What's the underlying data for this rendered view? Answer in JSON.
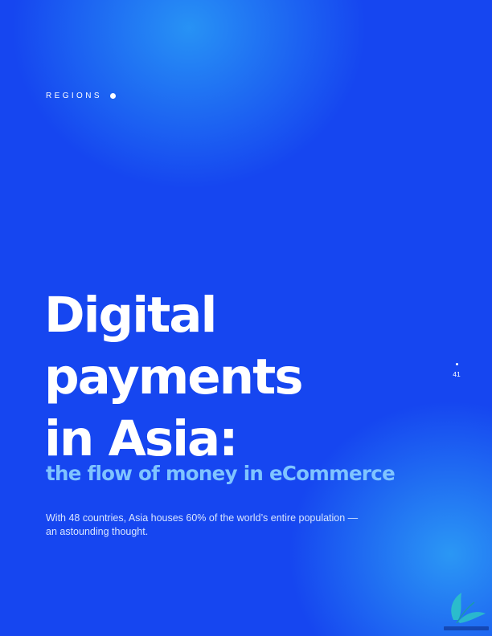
{
  "section": {
    "label": "REGIONS"
  },
  "title": {
    "lines": [
      "Digital",
      "payments",
      "in Asia:"
    ]
  },
  "subtitle": "the flow of money in eCommerce",
  "intro": {
    "lines": [
      "With 48 countries, Asia houses 60% of the world’s entire population —",
      "an astounding thought."
    ]
  },
  "page": {
    "number": "41"
  },
  "colors": {
    "background": "#1646f0",
    "highlight": "#2896f5",
    "subtitle": "#7fc4ff",
    "text": "#ffffff"
  },
  "icons": {
    "section_marker": "dot-icon",
    "page_marker": "dot-icon",
    "watermark": "leaf-logo-icon"
  }
}
